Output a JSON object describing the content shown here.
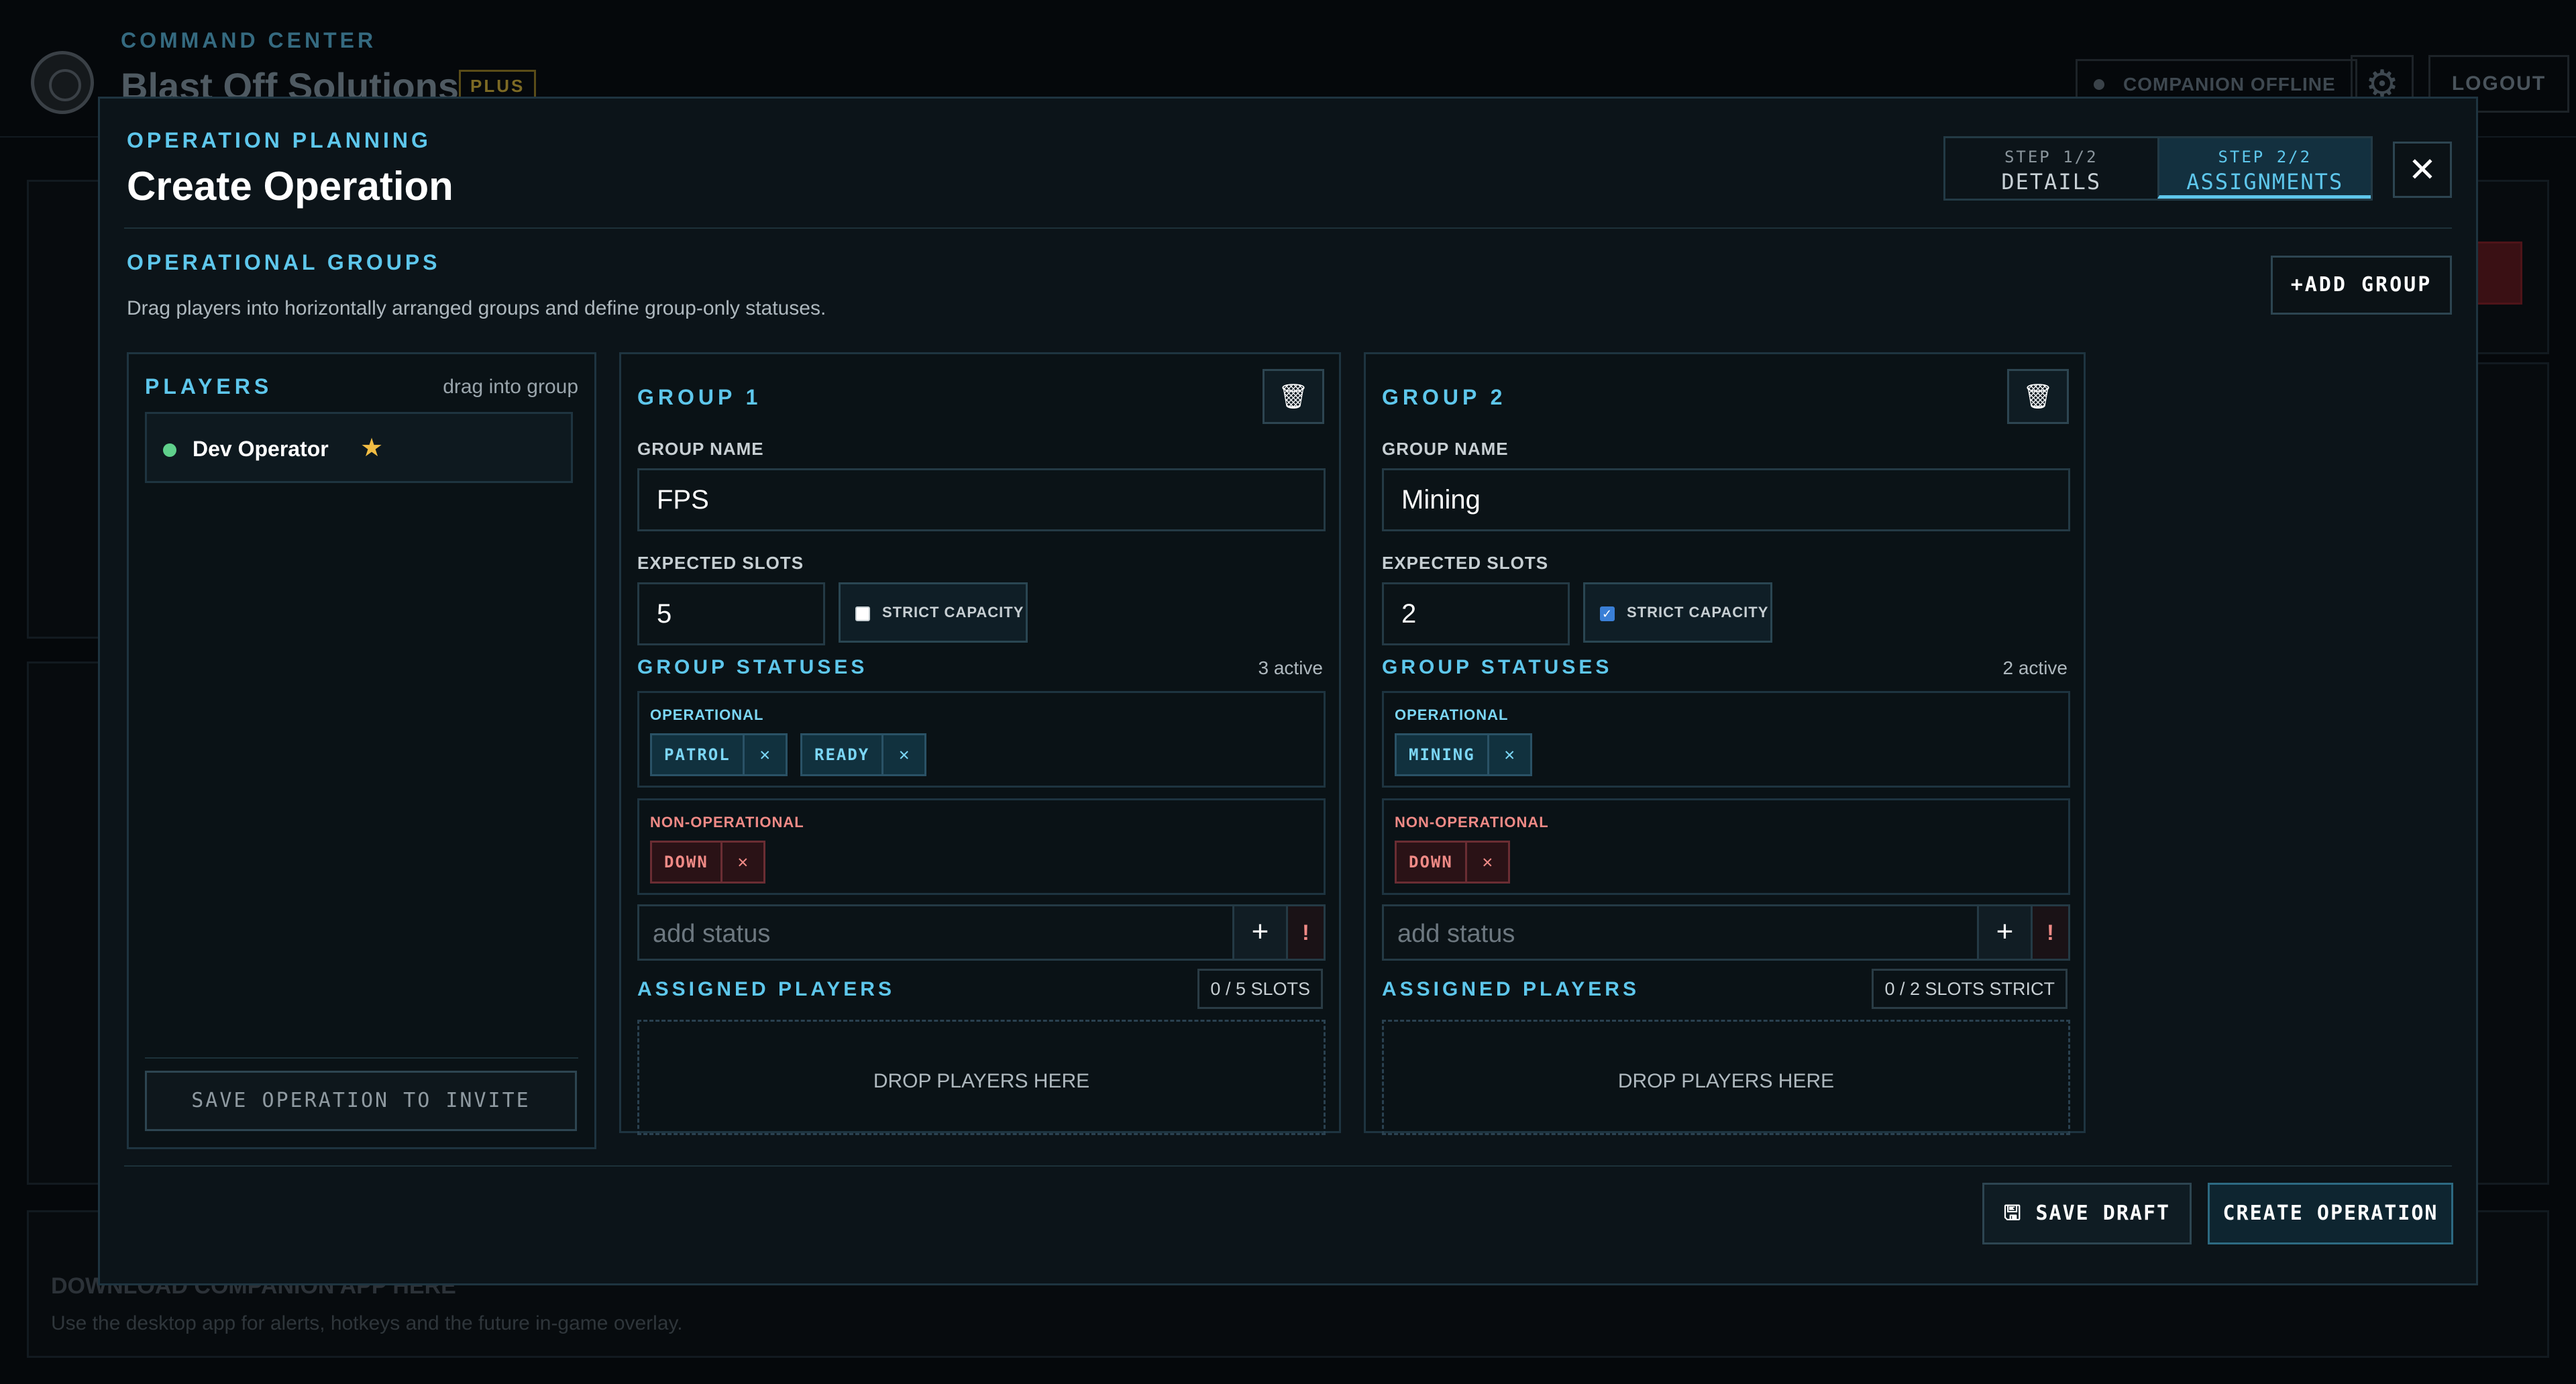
{
  "background": {
    "section_label": "COMMAND CENTER",
    "org_name": "Blast Off Solutions",
    "plan_badge": "PLUS",
    "companion_status": "COMPANION OFFLINE",
    "logout_label": "LOGOUT",
    "companion_download_title": "DOWNLOAD COMPANION APP HERE",
    "companion_download_desc": "Use the desktop app for alerts, hotkeys and the future in-game overlay."
  },
  "modal": {
    "eyebrow": "OPERATION PLANNING",
    "title": "Create Operation",
    "steps": [
      {
        "step": "STEP 1/2",
        "label": "DETAILS"
      },
      {
        "step": "STEP 2/2",
        "label": "ASSIGNMENTS"
      }
    ],
    "close_icon": "close-icon",
    "groups_title": "OPERATIONAL GROUPS",
    "groups_desc": "Drag players into horizontally arranged groups and define group-only statuses.",
    "add_group_label": "ADD GROUP",
    "save_draft_label": "SAVE DRAFT",
    "create_label": "CREATE OPERATION"
  },
  "players_panel": {
    "title": "PLAYERS",
    "hint": "drag into group",
    "players": [
      {
        "name": "Dev Operator",
        "online": true,
        "starred": true
      }
    ],
    "save_invite_label": "SAVE OPERATION TO INVITE"
  },
  "labels": {
    "group_name": "GROUP NAME",
    "expected_slots": "EXPECTED SLOTS",
    "strict_capacity": "STRICT CAPACITY",
    "group_statuses": "GROUP STATUSES",
    "operational": "OPERATIONAL",
    "non_operational": "NON-OPERATIONAL",
    "add_status_placeholder": "add status",
    "assigned_players": "ASSIGNED PLAYERS",
    "drop_here": "DROP PLAYERS HERE"
  },
  "groups": [
    {
      "title": "GROUP 1",
      "name": "FPS",
      "expected_slots": "5",
      "strict_capacity": false,
      "active_count": "3 active",
      "operational": [
        "PATROL",
        "READY"
      ],
      "non_operational": [
        "DOWN"
      ],
      "slots": "0 / 5 SLOTS"
    },
    {
      "title": "GROUP 2",
      "name": "Mining",
      "expected_slots": "2",
      "strict_capacity": true,
      "active_count": "2 active",
      "operational": [
        "MINING"
      ],
      "non_operational": [
        "DOWN"
      ],
      "slots": "0 / 2 SLOTS STRICT"
    }
  ],
  "colors": {
    "accent": "#5ec7ec",
    "operational_tag": "#7bd6f5",
    "non_operational_tag": "#f08a86",
    "online_dot": "#5fd08b",
    "star": "#f1bd44"
  }
}
